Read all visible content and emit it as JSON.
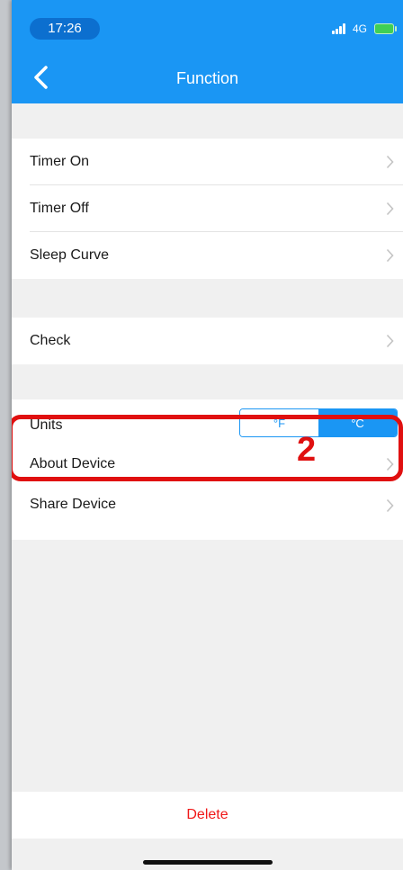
{
  "status_bar": {
    "time": "17:26",
    "network": "4G",
    "signal_icon": "signal-bars-icon",
    "battery_icon": "battery-charging-icon"
  },
  "header": {
    "title": "Function",
    "back_icon": "chevron-left-icon",
    "background_color": "#1a96f4"
  },
  "groups": [
    {
      "rows": [
        {
          "label": "Timer On",
          "icon": "chevron-right-icon"
        },
        {
          "label": "Timer Off",
          "icon": "chevron-right-icon"
        },
        {
          "label": "Sleep Curve",
          "icon": "chevron-right-icon"
        }
      ]
    },
    {
      "rows": [
        {
          "label": "Check",
          "icon": "chevron-right-icon"
        }
      ]
    },
    {
      "rows": [
        {
          "label": "Units",
          "toggle": {
            "options": [
              "°F",
              "°C"
            ],
            "selected": "°C"
          }
        },
        {
          "label": "About Device",
          "icon": "chevron-right-icon"
        },
        {
          "label": "Share Device",
          "icon": "chevron-right-icon"
        }
      ]
    }
  ],
  "annotation": {
    "step": "2",
    "color": "#e01010"
  },
  "footer": {
    "delete_label": "Delete",
    "delete_color": "#f01818"
  }
}
